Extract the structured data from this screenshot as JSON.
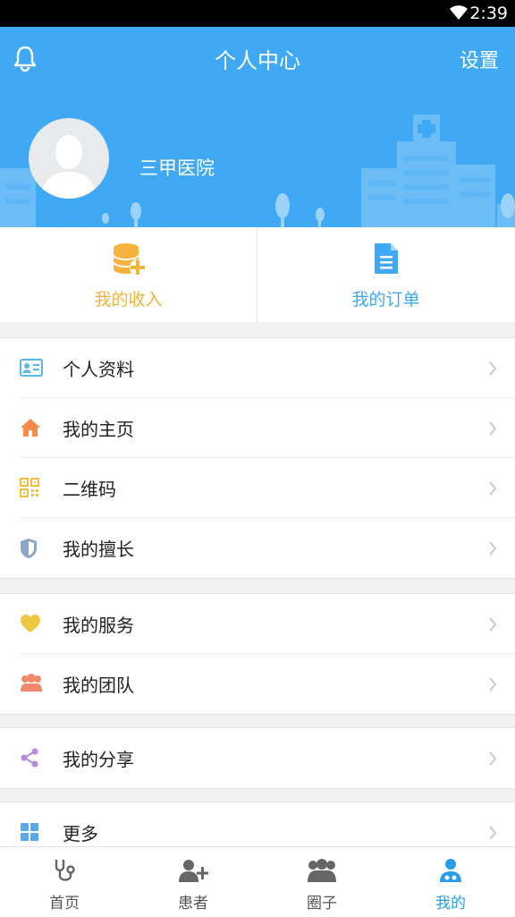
{
  "status_bar": {
    "time": "2:39"
  },
  "header": {
    "title": "个人中心",
    "settings_label": "设置",
    "hospital_name": "三甲医院"
  },
  "quick_actions": [
    {
      "label": "我的收入",
      "icon": "coin-stack-plus-icon",
      "color": "#f5b33b"
    },
    {
      "label": "我的订单",
      "icon": "document-icon",
      "color": "#3fa9f5"
    }
  ],
  "menu_groups": [
    [
      {
        "label": "个人资料",
        "icon": "id-card-icon",
        "color": "#5ab8e8"
      },
      {
        "label": "我的主页",
        "icon": "home-icon",
        "color": "#f58a4b"
      },
      {
        "label": "二维码",
        "icon": "qr-code-icon",
        "color": "#f0c040"
      },
      {
        "label": "我的擅长",
        "icon": "shield-icon",
        "color": "#8aa6c8"
      }
    ],
    [
      {
        "label": "我的服务",
        "icon": "heart-icon",
        "color": "#f0c840"
      },
      {
        "label": "我的团队",
        "icon": "team-icon",
        "color": "#f08a6a"
      }
    ],
    [
      {
        "label": "我的分享",
        "icon": "share-icon",
        "color": "#b58ae0"
      }
    ],
    [
      {
        "label": "更多",
        "icon": "grid-icon",
        "color": "#5aa8e8"
      }
    ]
  ],
  "tabs": [
    {
      "label": "首页",
      "icon": "stethoscope-icon"
    },
    {
      "label": "患者",
      "icon": "add-patient-icon"
    },
    {
      "label": "圈子",
      "icon": "group-icon"
    },
    {
      "label": "我的",
      "icon": "doctor-icon",
      "active": true
    }
  ],
  "colors": {
    "header_bg": "#3fa9f5",
    "active_tab": "#2a9de8"
  }
}
